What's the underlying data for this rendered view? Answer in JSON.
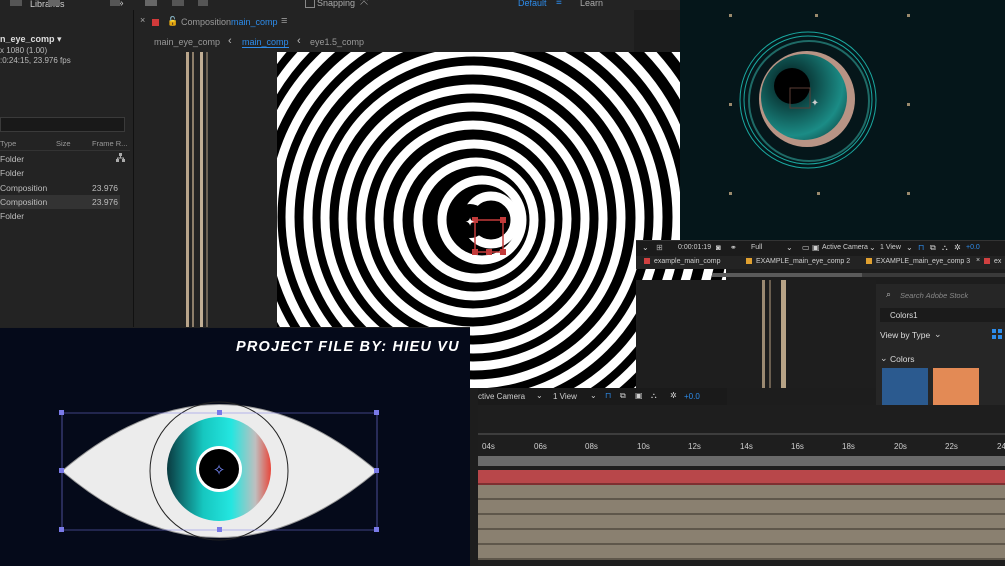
{
  "topbar": {
    "libraries_tab": "Libraries",
    "expand_glyph": "»",
    "snapping_label": "Snapping",
    "workspace_default": "Default",
    "workspace_menu": "≡",
    "workspace_learn": "Learn"
  },
  "project": {
    "comp_name": "n_eye_comp ▾",
    "comp_res": "x 1080 (1.00)",
    "comp_duration": ":0:24:15, 23.976 fps",
    "columns": [
      "Type",
      "Size",
      "Frame R..."
    ],
    "rows": [
      {
        "type": "Folder",
        "frame": ""
      },
      {
        "type": "Folder",
        "frame": ""
      },
      {
        "type": "Composition",
        "frame": "23.976"
      },
      {
        "type": "Composition",
        "frame": "23.976"
      },
      {
        "type": "Folder",
        "frame": ""
      }
    ]
  },
  "composition": {
    "panel_title_prefix": "Composition",
    "panel_title_name": "main_comp",
    "menu_glyph": "≡",
    "crumbs": [
      "main_eye_comp",
      "main_comp",
      "eye1.5_comp"
    ],
    "crumb_sep": "‹"
  },
  "overlay_text": "PROJECT FILE BY: HIEU VU",
  "viewer_hud": {
    "camera": "ctive Camera",
    "view": "1 View",
    "exposure": "+0.0"
  },
  "small_comp": {
    "timecode": "0:00:01:19",
    "resolution": "Full",
    "camera": "Active Camera",
    "view": "1 View",
    "exposure": "+0.0",
    "tabs": [
      {
        "label": "example_main_comp",
        "color": "#d04040"
      },
      {
        "label": "EXAMPLE_main_eye_comp 2",
        "color": "#e0a030"
      },
      {
        "label": "EXAMPLE_main_eye_comp 3",
        "color": "#e0a030"
      },
      {
        "label": "ex",
        "color": "#d04040"
      }
    ],
    "close_glyph": "×"
  },
  "libraries": {
    "search_placeholder": "Search Adobe Stock",
    "library_name": "Colors1",
    "view_by": "View by Type",
    "section": "Colors",
    "swatches": [
      "#2b5a8f",
      "#e38a55"
    ]
  },
  "timeline": {
    "ticks": [
      "04s",
      "06s",
      "08s",
      "10s",
      "12s",
      "14s",
      "16s",
      "18s",
      "20s",
      "22s",
      "24"
    ],
    "layer_count": 6,
    "accent": "#c04646"
  },
  "colors": {
    "accent_blue": "#2d8ceb",
    "eye_teal": "#1ee3d8",
    "eye_red": "#e8463a",
    "overlay_bg": "#050a1a"
  }
}
